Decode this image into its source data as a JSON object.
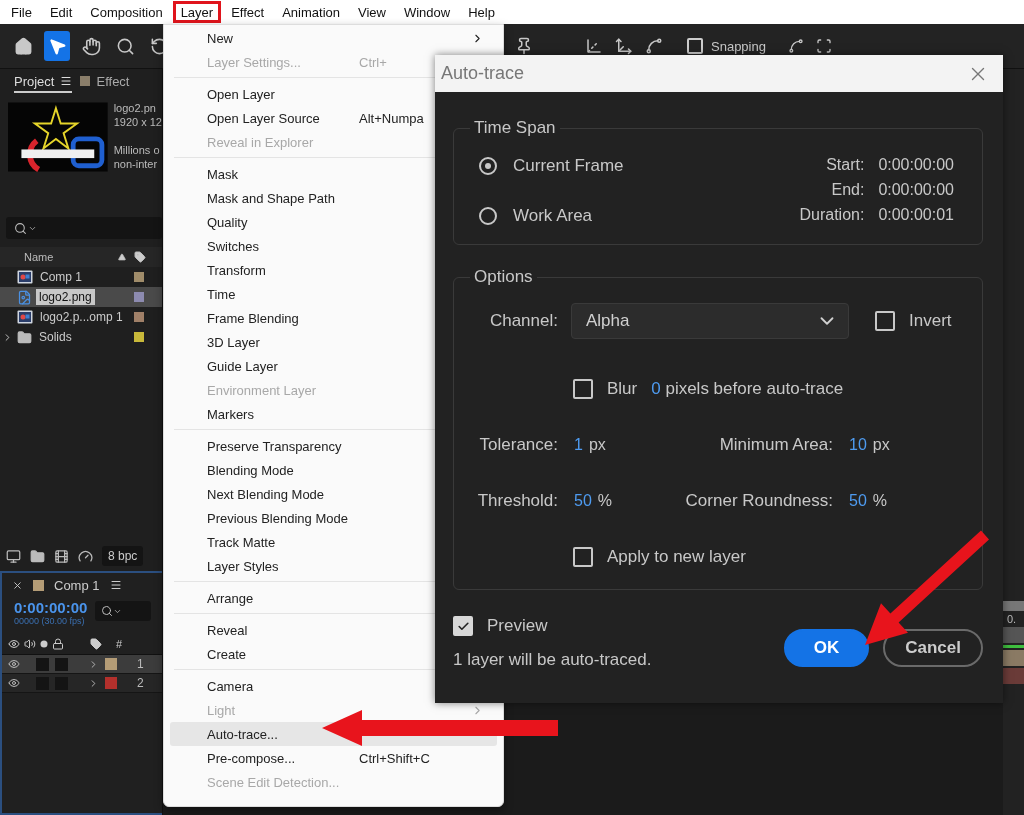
{
  "menubar": [
    {
      "label": "File",
      "selected": false
    },
    {
      "label": "Edit",
      "selected": false
    },
    {
      "label": "Composition",
      "selected": false
    },
    {
      "label": "Layer",
      "selected": true
    },
    {
      "label": "Effect",
      "selected": false
    },
    {
      "label": "Animation",
      "selected": false
    },
    {
      "label": "View",
      "selected": false
    },
    {
      "label": "Window",
      "selected": false
    },
    {
      "label": "Help",
      "selected": false
    }
  ],
  "toolbar": {
    "tools": [
      {
        "kind": "home",
        "selected": false
      },
      {
        "kind": "select",
        "selected": true
      },
      {
        "kind": "hand",
        "selected": false
      },
      {
        "kind": "zoom",
        "selected": false
      },
      {
        "kind": "orbit",
        "selected": false
      }
    ],
    "snapping": {
      "label": "Snapping",
      "checked": false
    }
  },
  "project_panel": {
    "tabs": [
      {
        "label": "Project",
        "selected": true
      },
      {
        "label": "Effect",
        "selected": false
      }
    ],
    "info": [
      "logo2.pn",
      "1920 x 12",
      "Millions o",
      "non-inter"
    ],
    "name_column": "Name",
    "items": [
      {
        "name": "Comp 1",
        "kind": "comp",
        "color": "#a08c6a",
        "selected": false
      },
      {
        "name": "logo2.png",
        "kind": "image",
        "color": "#8d8bb0",
        "selected": true
      },
      {
        "name": "logo2.p...omp 1",
        "kind": "comp",
        "color": "#a08068",
        "selected": false
      },
      {
        "name": "Solids",
        "kind": "folder",
        "color": "#c8b83a",
        "selected": false
      }
    ]
  },
  "bit_depth": "8 bpc",
  "timeline": {
    "tab": "Comp 1",
    "timecode": "0:00:00:00",
    "fps": "00000 (30.00 fps)",
    "number_column": "#",
    "layers": [
      {
        "number": "1",
        "color": "#b49c76",
        "selected": true
      },
      {
        "number": "2",
        "color": "#b3302c",
        "selected": false
      }
    ]
  },
  "ruler_label": "0.",
  "layer_menu": {
    "groups": [
      {
        "items": [
          {
            "label": "New",
            "disabled": false,
            "highlighted": false,
            "submenu": true
          },
          {
            "label": "Layer Settings...",
            "shortcut": "Ctrl+",
            "disabled": true,
            "highlighted": false,
            "submenu": false
          }
        ]
      },
      {
        "items": [
          {
            "label": "Open Layer",
            "disabled": false,
            "highlighted": false,
            "submenu": false
          },
          {
            "label": "Open Layer Source",
            "shortcut": "Alt+Numpa",
            "disabled": false,
            "highlighted": false,
            "submenu": false
          },
          {
            "label": "Reveal in Explorer",
            "disabled": true,
            "highlighted": false,
            "submenu": false
          }
        ]
      },
      {
        "items": [
          {
            "label": "Mask",
            "disabled": false,
            "highlighted": false,
            "submenu": false
          },
          {
            "label": "Mask and Shape Path",
            "disabled": false,
            "highlighted": false,
            "submenu": false
          },
          {
            "label": "Quality",
            "disabled": false,
            "highlighted": false,
            "submenu": false
          },
          {
            "label": "Switches",
            "disabled": false,
            "highlighted": false,
            "submenu": false
          },
          {
            "label": "Transform",
            "disabled": false,
            "highlighted": false,
            "submenu": false
          },
          {
            "label": "Time",
            "disabled": false,
            "highlighted": false,
            "submenu": false
          },
          {
            "label": "Frame Blending",
            "disabled": false,
            "highlighted": false,
            "submenu": false
          },
          {
            "label": "3D Layer",
            "disabled": false,
            "highlighted": false,
            "submenu": false
          },
          {
            "label": "Guide Layer",
            "disabled": false,
            "highlighted": false,
            "submenu": false
          },
          {
            "label": "Environment Layer",
            "disabled": true,
            "highlighted": false,
            "submenu": false
          },
          {
            "label": "Markers",
            "disabled": false,
            "highlighted": false,
            "submenu": false
          }
        ]
      },
      {
        "items": [
          {
            "label": "Preserve Transparency",
            "disabled": false,
            "highlighted": false,
            "submenu": false
          },
          {
            "label": "Blending Mode",
            "disabled": false,
            "highlighted": false,
            "submenu": false
          },
          {
            "label": "Next Blending Mode",
            "disabled": false,
            "highlighted": false,
            "submenu": false
          },
          {
            "label": "Previous Blending Mode",
            "disabled": false,
            "highlighted": false,
            "submenu": false
          },
          {
            "label": "Track Matte",
            "disabled": false,
            "highlighted": false,
            "submenu": false
          },
          {
            "label": "Layer Styles",
            "disabled": false,
            "highlighted": false,
            "submenu": false
          }
        ]
      },
      {
        "items": [
          {
            "label": "Arrange",
            "disabled": false,
            "highlighted": false,
            "submenu": false
          }
        ]
      },
      {
        "items": [
          {
            "label": "Reveal",
            "disabled": false,
            "highlighted": false,
            "submenu": false
          },
          {
            "label": "Create",
            "disabled": false,
            "highlighted": false,
            "submenu": false
          }
        ]
      },
      {
        "items": [
          {
            "label": "Camera",
            "disabled": false,
            "highlighted": false,
            "submenu": false
          },
          {
            "label": "Light",
            "disabled": true,
            "highlighted": false,
            "submenu": true
          },
          {
            "label": "Auto-trace...",
            "disabled": false,
            "highlighted": true,
            "submenu": false
          },
          {
            "label": "Pre-compose...",
            "shortcut": "Ctrl+Shift+C",
            "disabled": false,
            "highlighted": false,
            "submenu": false
          },
          {
            "label": "Scene Edit Detection...",
            "disabled": true,
            "highlighted": false,
            "submenu": false
          }
        ]
      }
    ]
  },
  "dialog": {
    "title": "Auto-trace",
    "time_span": {
      "title": "Time Span",
      "options": [
        {
          "label": "Current Frame",
          "selected": true
        },
        {
          "label": "Work Area",
          "selected": false
        }
      ],
      "times": [
        {
          "label": "Start:",
          "value": "0:00:00:00"
        },
        {
          "label": "End:",
          "value": "0:00:00:00"
        },
        {
          "label": "Duration:",
          "value": "0:00:00:01"
        }
      ]
    },
    "options": {
      "title": "Options",
      "channel": {
        "label": "Channel:",
        "value": "Alpha"
      },
      "invert": {
        "label": "Invert",
        "checked": false
      },
      "blur": {
        "label": "Blur",
        "checked": false,
        "value": "0",
        "suffix": "pixels before auto-trace"
      },
      "fields": [
        {
          "label": "Tolerance:",
          "value": "1",
          "unit": "px"
        },
        {
          "label": "Minimum Area:",
          "value": "10",
          "unit": "px"
        },
        {
          "label": "Threshold:",
          "value": "50",
          "unit": "%"
        },
        {
          "label": "Corner Roundness:",
          "value": "50",
          "unit": "%"
        }
      ],
      "apply": {
        "label": "Apply to new layer",
        "checked": false
      }
    },
    "preview": {
      "label": "Preview",
      "checked": true
    },
    "status": "1 layer will be auto-traced.",
    "buttons": [
      {
        "label": "OK",
        "kind": "primary"
      },
      {
        "label": "Cancel",
        "kind": "secondary"
      }
    ]
  }
}
